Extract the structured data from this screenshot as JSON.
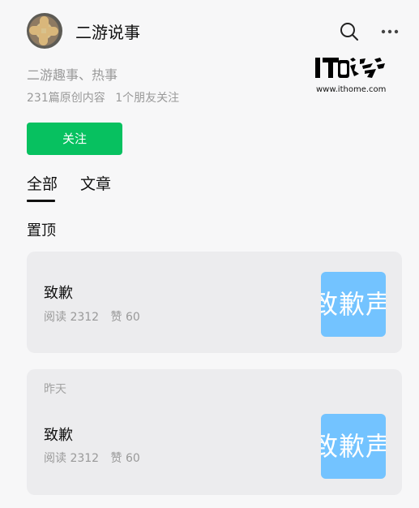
{
  "profile": {
    "name": "二游说事",
    "intro": "二游趣事、热事",
    "original_count": "231篇原创内容",
    "friends_following": "1个朋友关注",
    "follow_label": "关注"
  },
  "header": {
    "icons": [
      "search-icon",
      "more-options-icon"
    ]
  },
  "watermark": {
    "url": "www.ithome.com"
  },
  "tabs": {
    "all": "全部",
    "articles": "文章"
  },
  "sections": {
    "pinned": "置顶"
  },
  "articles": [
    {
      "title": "致歉",
      "reads": "阅读 2312",
      "likes": "赞 60",
      "thumbnail_text": "致歉声明"
    },
    {
      "date": "昨天",
      "title": "致歉",
      "reads": "阅读 2312",
      "likes": "赞 60",
      "thumbnail_text": "致歉声明"
    }
  ],
  "colors": {
    "page_background": "#f7f7f8",
    "card_background": "#ececee",
    "follow_button": "#07c160",
    "thumbnail": "#73c3ff"
  }
}
